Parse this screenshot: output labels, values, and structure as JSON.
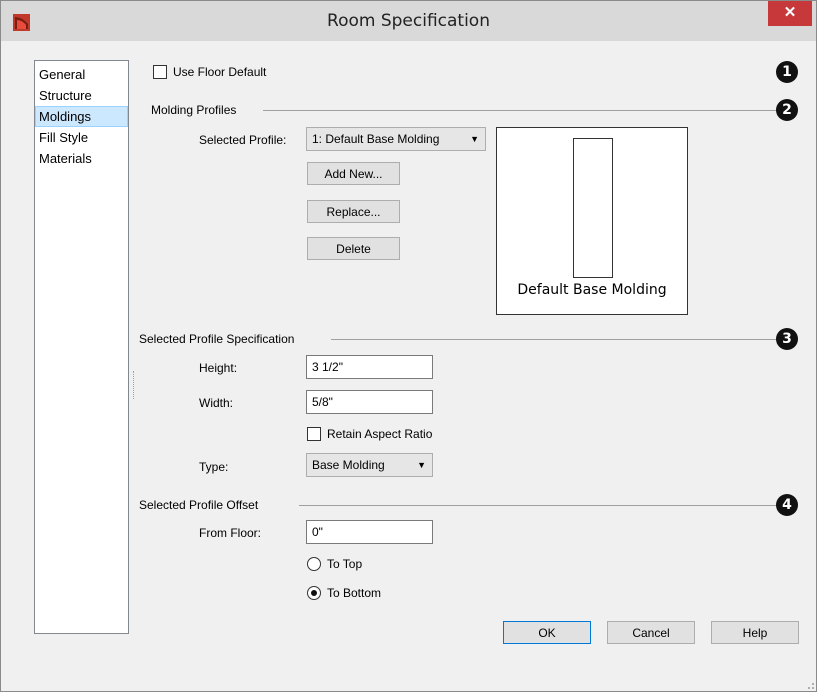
{
  "window": {
    "title": "Room Specification",
    "close_glyph": "✕",
    "accent_close": "#c7383a"
  },
  "nav": {
    "items": [
      "General",
      "Structure",
      "Moldings",
      "Fill Style",
      "Materials"
    ],
    "selected": "Moldings"
  },
  "use_floor_default": {
    "label": "Use Floor Default",
    "checked": false
  },
  "badges": [
    "1",
    "2",
    "3",
    "4"
  ],
  "molding_profiles": {
    "group_title": "Molding Profiles",
    "selected_profile_label": "Selected Profile:",
    "selected_profile_value": "1:  Default Base Molding",
    "add_new": "Add New...",
    "replace": "Replace...",
    "delete": "Delete",
    "preview_caption": "Default Base Molding"
  },
  "profile_spec": {
    "group_title": "Selected Profile Specification",
    "height_label": "Height:",
    "height_value": "3 1/2\"",
    "width_label": "Width:",
    "width_value": "5/8\"",
    "retain_label": "Retain Aspect Ratio",
    "retain_checked": false,
    "type_label": "Type:",
    "type_value": "Base Molding"
  },
  "profile_offset": {
    "group_title": "Selected Profile Offset",
    "from_floor_label": "From Floor:",
    "from_floor_value": "0\"",
    "to_top_label": "To Top",
    "to_bottom_label": "To Bottom",
    "selected": "To Bottom"
  },
  "buttons": {
    "ok": "OK",
    "cancel": "Cancel",
    "help": "Help"
  }
}
